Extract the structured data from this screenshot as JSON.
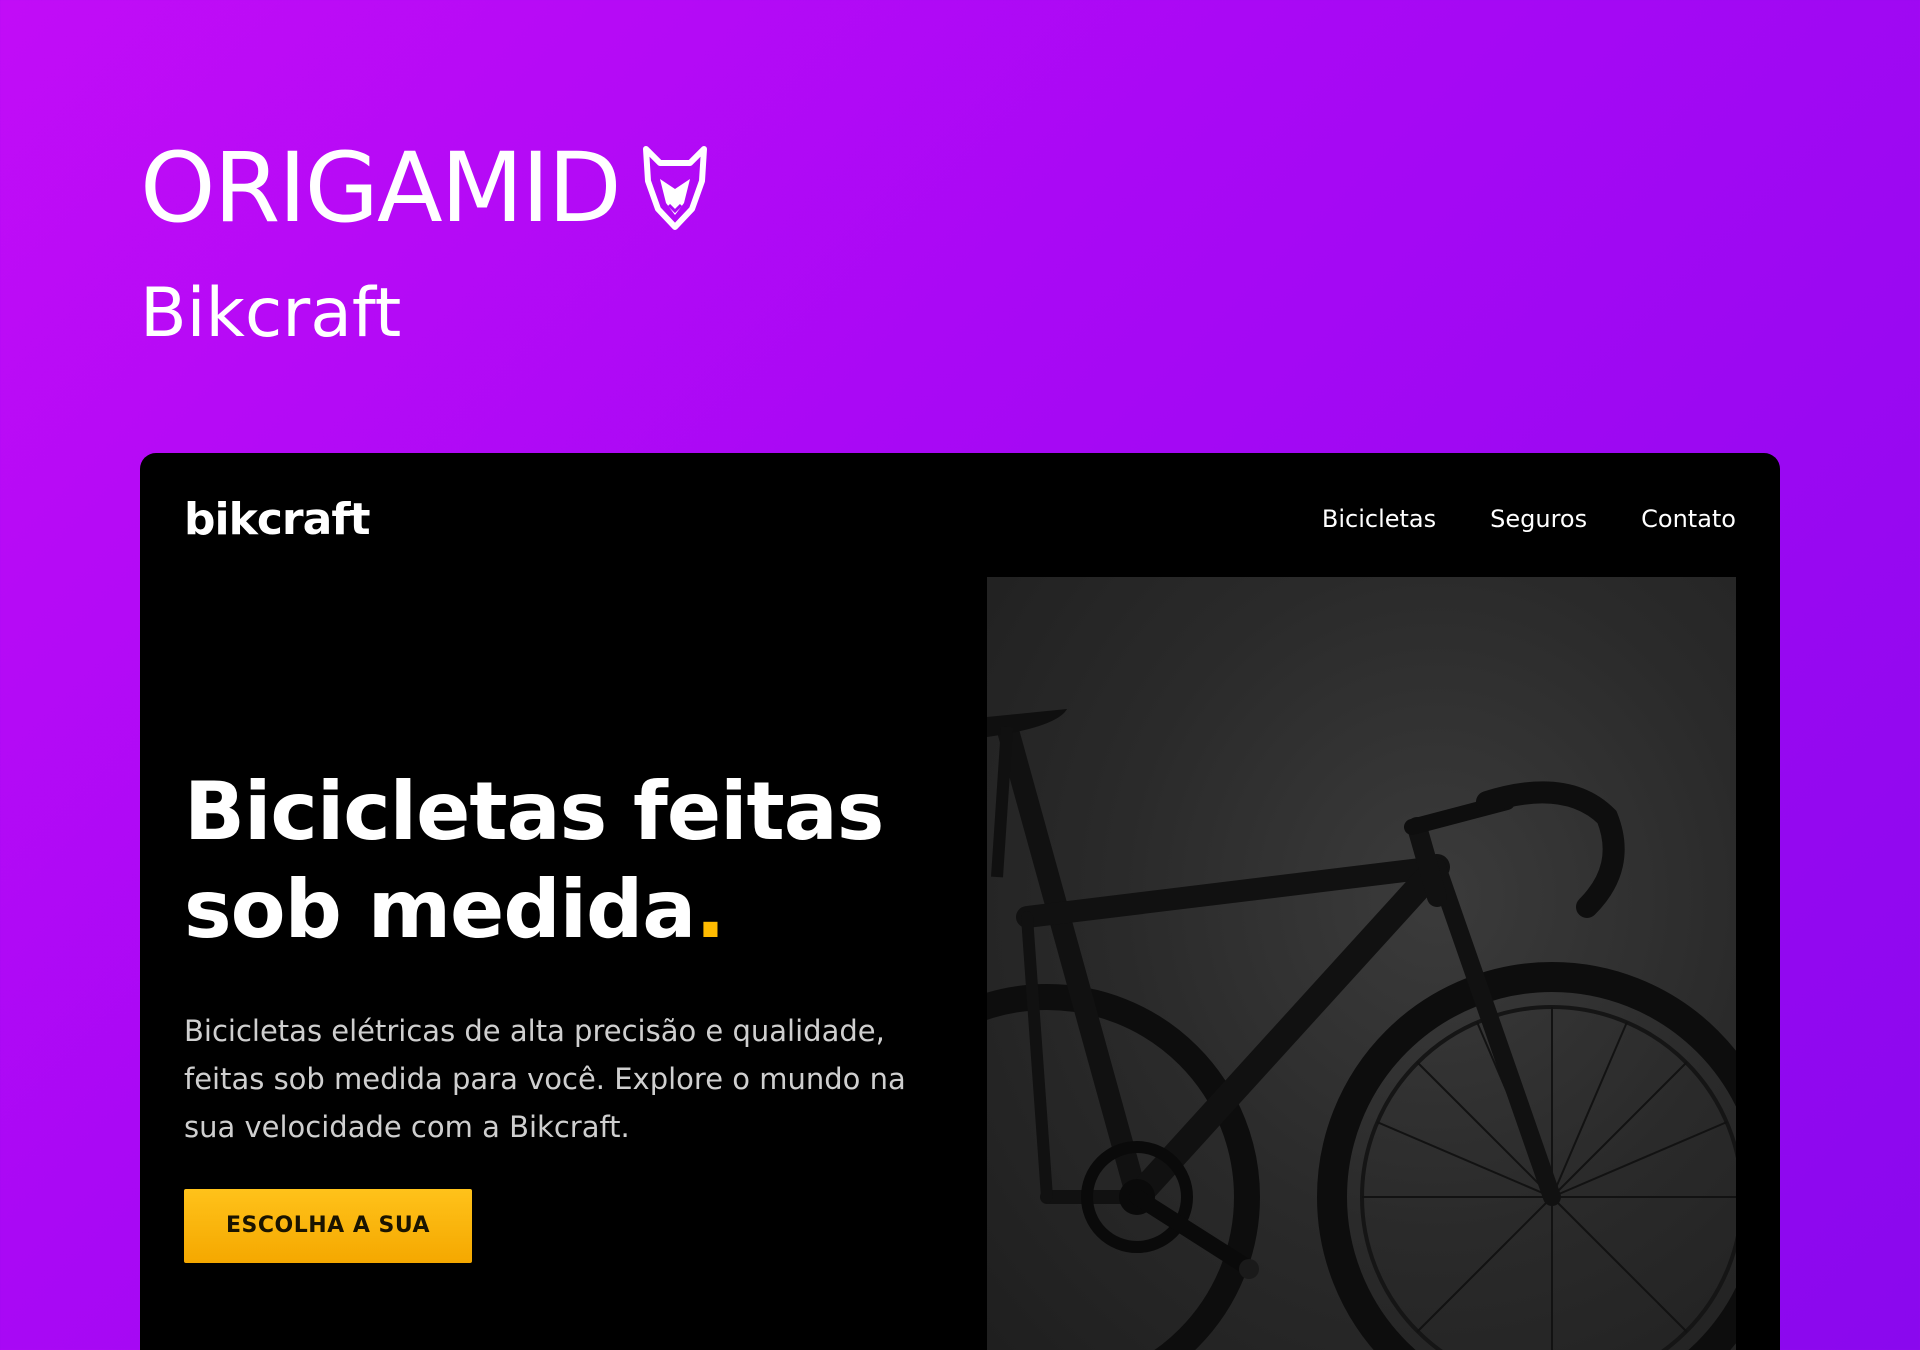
{
  "brand": {
    "wordmark": "ORIGAMID",
    "subtitle": "Bikcraft",
    "logo_icon": "fox-head-icon"
  },
  "site": {
    "logo": "bikcraft",
    "nav": [
      {
        "label": "Bicicletas"
      },
      {
        "label": "Seguros"
      },
      {
        "label": "Contato"
      }
    ]
  },
  "hero": {
    "title_line1": "Bicicletas feitas",
    "title_line2": "sob medida",
    "title_dot": ".",
    "description": "Bicicletas elétricas de alta precisão e qualidade, feitas sob medida para você. Explore o mundo na sua velocidade com a Bikcraft.",
    "cta_label": "ESCOLHA A SUA",
    "image_icon": "road-bike-photo"
  },
  "colors": {
    "background_start": "#c20cf7",
    "background_end": "#8a08ee",
    "card": "#000000",
    "accent": "#ffbb00",
    "text": "#ffffff",
    "muted_text": "#cfcfcf"
  }
}
